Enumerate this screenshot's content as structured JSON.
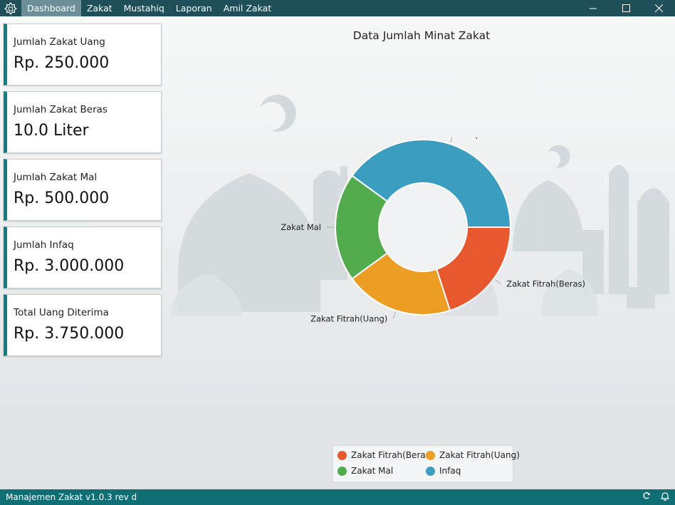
{
  "menu": {
    "items": [
      {
        "label": "Dashboard",
        "active": true
      },
      {
        "label": "Zakat"
      },
      {
        "label": "Mustahiq"
      },
      {
        "label": "Laporan"
      },
      {
        "label": "Amil Zakat"
      }
    ]
  },
  "window_controls": [
    "minimize-icon",
    "maximize-icon",
    "close-icon"
  ],
  "cards": [
    {
      "label": "Jumlah Zakat Uang",
      "value": "Rp. 250.000"
    },
    {
      "label": "Jumlah Zakat Beras",
      "value": "10.0 Liter"
    },
    {
      "label": "Jumlah Zakat Mal",
      "value": "Rp. 500.000"
    },
    {
      "label": "Jumlah Infaq",
      "value": "Rp. 3.000.000"
    },
    {
      "label": "Total Uang Diterima",
      "value": "Rp. 3.750.000"
    }
  ],
  "chart_data": {
    "type": "pie",
    "donut": true,
    "title": "Data Jumlah Minat Zakat",
    "slices": [
      {
        "label": "Zakat Fitrah(Beras)",
        "value": 2,
        "color": "#e8582f"
      },
      {
        "label": "Zakat Fitrah(Uang)",
        "value": 2,
        "color": "#eb9d24"
      },
      {
        "label": "Zakat Mal",
        "value": 2,
        "color": "#52ab4d"
      },
      {
        "label": "Infaq",
        "value": 4,
        "color": "#3b9ec0"
      }
    ],
    "legend_position": "bottom"
  },
  "status": {
    "text": "Manajemen Zakat v1.0.3 rev d",
    "icons": [
      "refresh-icon",
      "bell-icon"
    ]
  },
  "colors": {
    "topbar": "#1f4f58",
    "menu_active": "#6d8f97",
    "accent": "#0f7f86",
    "statusbar": "#0f6e74"
  }
}
